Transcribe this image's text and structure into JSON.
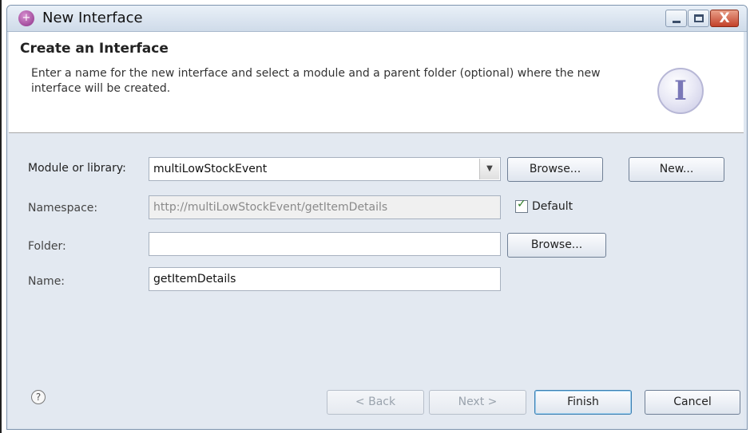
{
  "window": {
    "title": "New Interface"
  },
  "header": {
    "title": "Create an Interface",
    "description": "Enter a name for the new interface and select a module and a parent folder (optional) where the new interface will be created.",
    "icon": "interface-wizard-icon"
  },
  "form": {
    "module": {
      "label": "Module or library:",
      "value": "multiLowStockEvent",
      "browse_label": "Browse...",
      "new_label": "New..."
    },
    "namespace": {
      "label": "Namespace:",
      "value": "http://multiLowStockEvent/getItemDetails",
      "default_label": "Default",
      "default_checked": true
    },
    "folder": {
      "label": "Folder:",
      "value": "",
      "browse_label": "Browse..."
    },
    "name": {
      "label": "Name:",
      "value": "getItemDetails"
    }
  },
  "footer": {
    "back_label": "< Back",
    "next_label": "Next >",
    "finish_label": "Finish",
    "cancel_label": "Cancel"
  },
  "icons": {
    "help": "?",
    "close": "X",
    "app": "+"
  }
}
